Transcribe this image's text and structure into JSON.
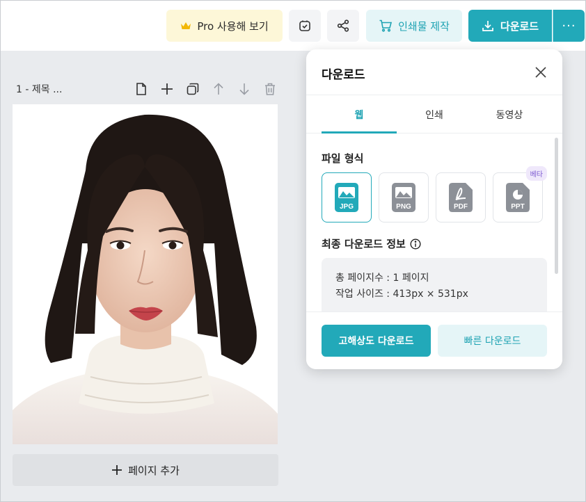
{
  "toolbar": {
    "pro_label": "Pro 사용해 보기",
    "print_label": "인쇄물 제작",
    "download_label": "다운로드",
    "more_label": "···",
    "accent_color": "#22a9b9"
  },
  "page": {
    "label": "1 - 제목 ...",
    "add_page_label": "페이지 추가"
  },
  "panel": {
    "title": "다운로드",
    "tabs": [
      {
        "label": "웹",
        "active": true
      },
      {
        "label": "인쇄",
        "active": false
      },
      {
        "label": "동영상",
        "active": false
      }
    ],
    "file_format_title": "파일 형식",
    "formats": [
      {
        "label": "JPG",
        "selected": true
      },
      {
        "label": "PNG",
        "selected": false
      },
      {
        "label": "PDF",
        "selected": false
      },
      {
        "label": "PPT",
        "selected": false
      }
    ],
    "beta_badge": "베타",
    "info_title": "최종 다운로드 정보",
    "info_pages": "총 페이지수 : 1 페이지",
    "info_size": "작업 사이즈 : 413px × 531px",
    "hq_download_label": "고해상도 다운로드",
    "fast_download_label": "빠른 다운로드"
  }
}
